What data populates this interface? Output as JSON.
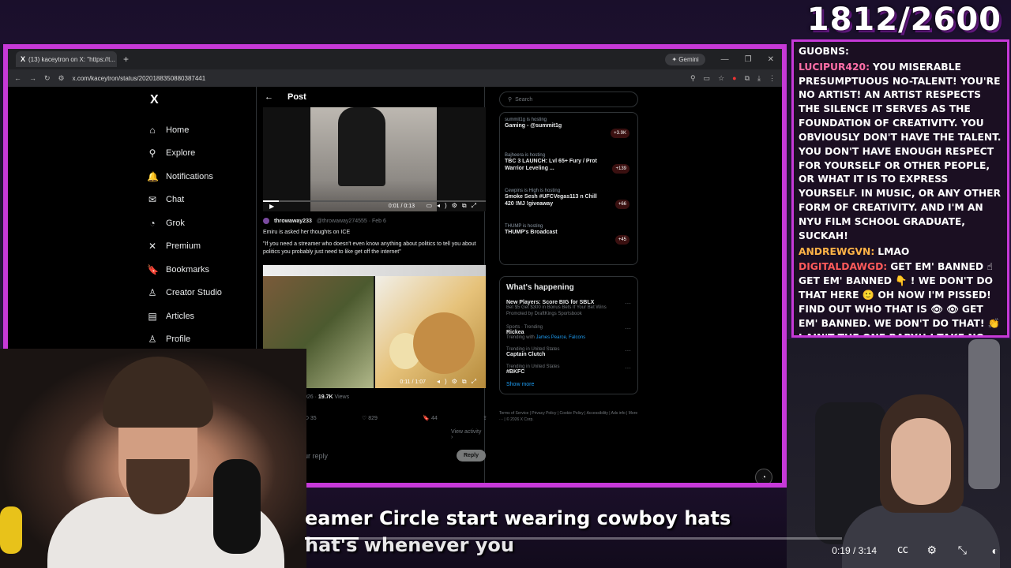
{
  "counter": "1812/2600",
  "browser": {
    "tab_title": "(13) kaceytron on X: \"https://t...",
    "tab_logo": "X",
    "new_tab": "+",
    "gemini": "Gemini",
    "url": "x.com/kaceytron/status/2020188350880387441"
  },
  "nav": {
    "logo": "X",
    "items": [
      {
        "label": "Home",
        "icon": "home-icon",
        "glyph": "⌂"
      },
      {
        "label": "Explore",
        "icon": "search-icon",
        "glyph": "⚲"
      },
      {
        "label": "Notifications",
        "icon": "bell-icon",
        "glyph": "🔔"
      },
      {
        "label": "Chat",
        "icon": "mail-icon",
        "glyph": "✉"
      },
      {
        "label": "Grok",
        "icon": "grok-icon",
        "glyph": "◔"
      },
      {
        "label": "Premium",
        "icon": "x-icon",
        "glyph": "✕"
      },
      {
        "label": "Bookmarks",
        "icon": "bookmark-icon",
        "glyph": "🔖"
      },
      {
        "label": "Creator Studio",
        "icon": "creator-icon",
        "glyph": "♙"
      },
      {
        "label": "Articles",
        "icon": "articles-icon",
        "glyph": "▤"
      },
      {
        "label": "Profile",
        "icon": "profile-icon",
        "glyph": "♙"
      }
    ]
  },
  "post": {
    "back": "←",
    "title": "Post",
    "video_time": "0:01 / 0:13",
    "quote_name": "throwaway233",
    "quote_handle": "@throwaway274555 · Feb 6",
    "quote_line1": "Emiru is asked her thoughts on ICE",
    "quote_line2": "\"If you need a streamer who doesn't even know anything about politics to tell you about politics you probably just need to like get off the internet\"",
    "media_time": "0:11 / 1:07",
    "stats_prefix": "026 · ",
    "views_count": "19.7K",
    "views_label": " Views",
    "retweets": "35",
    "likes": "829",
    "bookmarks": "44",
    "view_activity": "View activity ›",
    "reply_placeholder": "ur reply",
    "reply_button": "Reply"
  },
  "sidebar": {
    "search_placeholder": "Search",
    "spaces": [
      {
        "host": "summit1g is hosting",
        "title": "Gaming - @summit1g",
        "count": "+3.9K"
      },
      {
        "host": "Bajheera is hosting",
        "title": "TBC 3 LAUNCH: Lvl 65+ Fury / Prot Warrior Leveling ...",
        "count": "+139"
      },
      {
        "host": "Cewpins is High is hosting",
        "title": "Smoke Sesh #UFCVegas113 n Chill 420 !MJ !giveaway",
        "count": "+66"
      },
      {
        "host": "THUMP is hosting",
        "title": "THUMP's Broadcast",
        "count": "+45"
      }
    ],
    "happening_title": "What's happening",
    "trends": [
      {
        "meta": "",
        "name": "New Players: Score BIG for SBLX",
        "desc": "Bet $5 Get $300 in Bonus Bets If Your Bet Wins",
        "extra": "Promoted by DraftKings Sportsbook"
      },
      {
        "meta": "Sports · Trending",
        "name": "Rickea",
        "desc": "Trending with ",
        "extra": "James Pearce, Falcons"
      },
      {
        "meta": "Trending in United States",
        "name": "Captain Clutch",
        "desc": "",
        "extra": ""
      },
      {
        "meta": "Trending in United States",
        "name": "#BKFC",
        "desc": "",
        "extra": ""
      }
    ],
    "show_more": "Show more",
    "footer": "Terms of Service | Privacy Policy | Cookie Policy | Accessibility | Ads info | More ··· | © 2026 X Corp."
  },
  "chat": [
    {
      "user": "GUOBNS:",
      "text": "",
      "color": "#ffffff"
    },
    {
      "user": "LUCIPUR420:",
      "text": "YOU MISERABLE PRESUMPTUOUS NO-TALENT! YOU'RE NO ARTIST! AN ARTIST RESPECTS THE SILENCE IT SERVES AS THE FOUNDATION OF CREATIVITY. YOU OBVIOUSLY DON'T HAVE THE TALENT. YOU DON'T HAVE ENOUGH RESPECT FOR YOURSELF OR OTHER PEOPLE, OR WHAT IT IS TO EXPRESS YOURSELF. IN MUSIC, OR ANY OTHER FORM OF CREATIVITY. AND I'M AN NYU FILM SCHOOL GRADUATE, SUCKAH!",
      "color": "#ff6fa8"
    },
    {
      "user": "ANDREWGVN:",
      "text": "LMAO",
      "color": "#ffb347"
    },
    {
      "user": "DIGITALDAWGD:",
      "text": "GET EM' BANNED ☝ GET EM' BANNED 👇 ! WE DON'T DO THAT HERE 🙂 OH NOW I'M PISSED! FIND OUT WHO THAT IS 👁 👁 GET EM' BANNED. WE DON'T DO THAT! 👏 I AIN'T THE ONE BABY!! I TAKE NO DISRESPECT 💯 💯",
      "color": "#ff5a5a"
    }
  ],
  "subtitles": {
    "line1": "eamer Circle start wearing cowboy hats",
    "line2": "hat's whenever you"
  },
  "player": {
    "time": "0:19 / 3:14",
    "progress": 0.1
  }
}
